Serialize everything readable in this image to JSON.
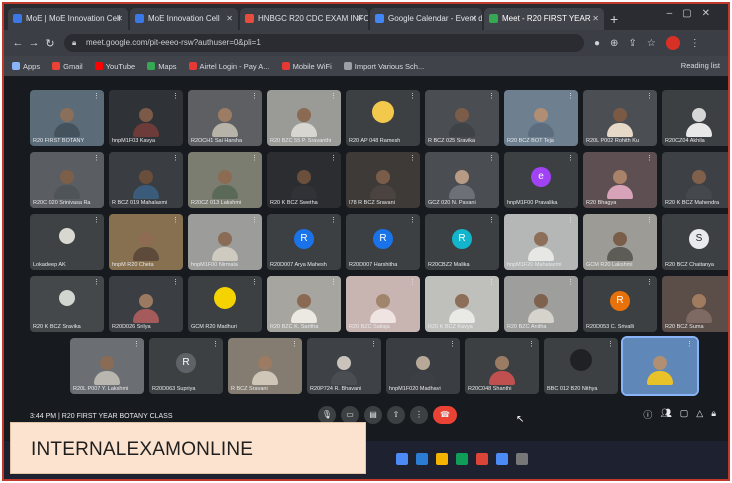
{
  "browser": {
    "tabs": [
      {
        "label": "MoE | MoE Innovation Cell",
        "fav_color": "#3b78e7"
      },
      {
        "label": "MoE Innovation Cell",
        "fav_color": "#3b78e7"
      },
      {
        "label": "HNBGC R20 CDC EXAM INFO",
        "fav_color": "#e84c3d"
      },
      {
        "label": "Google Calendar - Event de",
        "fav_color": "#4285f4"
      },
      {
        "label": "Meet - R20 FIRST YEAR",
        "fav_color": "#34a853"
      }
    ],
    "url": "meet.google.com/pit-eeeo-rsw?authuser=0&pli=1",
    "bookmarks": [
      {
        "label": "Apps",
        "color": "#8ab4f8"
      },
      {
        "label": "Gmail",
        "color": "#ea4335"
      },
      {
        "label": "YouTube",
        "color": "#ff0000"
      },
      {
        "label": "Maps",
        "color": "#34a853"
      },
      {
        "label": "Airtel Login - Pay A...",
        "color": "#e53935"
      },
      {
        "label": "Mobile WiFi",
        "color": "#e53935"
      },
      {
        "label": "Import Various Sch...",
        "color": "#9aa0a6"
      }
    ],
    "reading_list": "Reading list"
  },
  "meet": {
    "rows": [
      [
        {
          "name": "R20 FIRST BOTANY",
          "kind": "video",
          "bg": "#5b6b78",
          "skin": "#8a6f5a",
          "cloth": "#44525e"
        },
        {
          "name": "hnpM1F03 Kavya",
          "kind": "video",
          "bg": "#2f3236",
          "skin": "#7b5a47",
          "cloth": "#6e3b3b"
        },
        {
          "name": "R2OCH1 Sai Harsha",
          "kind": "video",
          "bg": "#5d5f63",
          "skin": "#9c7c62",
          "cloth": "#b7b3a8"
        },
        {
          "name": "R20 BZC 55 P. Sravanthi",
          "kind": "video",
          "bg": "#9a9a96",
          "skin": "#8a6a52",
          "cloth": "#d8d6d0"
        },
        {
          "name": "R20 AP 048 Ramesh",
          "kind": "logo",
          "bg": "#3c4043",
          "obj": "#f2c94c"
        },
        {
          "name": "R BCZ 025 Sravika",
          "kind": "video",
          "bg": "#4a4d52",
          "skin": "#7a5c48",
          "cloth": "#3f4347"
        },
        {
          "name": "R20 BCZ BOT Teja",
          "kind": "video",
          "bg": "#6e7f90",
          "skin": "#b08e74",
          "cloth": "#5c6d80"
        },
        {
          "name": "R20L P002 Rohith Ku",
          "kind": "video",
          "bg": "#4b4e53",
          "skin": "#7a5a44",
          "cloth": "#e6d9c7"
        },
        {
          "name": "R20CZ04 Akhila",
          "kind": "video",
          "bg": "#3c4043",
          "skin": "#d6d6d6",
          "cloth": "#e8e8e8"
        }
      ],
      [
        {
          "name": "R20C 020 Srinivasa Ra",
          "kind": "video",
          "bg": "#5a5d61",
          "skin": "#7d5f49",
          "cloth": "#4f5459"
        },
        {
          "name": "R BCZ 019 Mahalaxmi",
          "kind": "video",
          "bg": "#3a3d41",
          "skin": "#6a4e3c",
          "cloth": "#3a5b79"
        },
        {
          "name": "R20CZ 013 Lakshmi",
          "kind": "video",
          "bg": "#7b7d70",
          "skin": "#8c6b53",
          "cloth": "#5b6a58"
        },
        {
          "name": "R20 K BCZ Swetha",
          "kind": "video",
          "bg": "#2b2d30",
          "skin": "#6b4f3d",
          "cloth": "#2f3337"
        },
        {
          "name": "I78 R BCZ Sravani",
          "kind": "video",
          "bg": "#3e3a38",
          "skin": "#7a5d49",
          "cloth": "#4a4340"
        },
        {
          "name": "GCZ 020 N. Pavani",
          "kind": "video",
          "bg": "#4a4d51",
          "skin": "#b89b84",
          "cloth": "#6d7076"
        },
        {
          "name": "hnpM1F00 Pravalika",
          "kind": "avatar",
          "bg": "#3c4043",
          "av_color": "#a142f4",
          "letter": "e"
        },
        {
          "name": "R20 Bhagya",
          "kind": "video",
          "bg": "#5e5052",
          "skin": "#a9826a",
          "cloth": "#d8a3b8"
        },
        {
          "name": "R20 K BCZ Mahendra",
          "kind": "video",
          "bg": "#3d4044",
          "skin": "#80604a",
          "cloth": "#45494e"
        }
      ],
      [
        {
          "name": "Lokadeep AK",
          "kind": "object",
          "bg": "#3e4245",
          "obj": "#d8d8d0"
        },
        {
          "name": "hnpM R20 Cheta",
          "kind": "video",
          "bg": "#86704f",
          "skin": "#8e6b52",
          "cloth": "#5d4a3a"
        },
        {
          "name": "hnpM1F00 Nirmala",
          "kind": "video",
          "bg": "#9c9d9a",
          "skin": "#8a6b56",
          "cloth": "#cfcac0"
        },
        {
          "name": "R20D007 Arya Mahesh",
          "kind": "avatar",
          "bg": "#3c4043",
          "av_color": "#1a73e8",
          "letter": "R"
        },
        {
          "name": "R20D007 Harshitha",
          "kind": "avatar",
          "bg": "#3c4043",
          "av_color": "#1a73e8",
          "letter": "R"
        },
        {
          "name": "R20CBZ2 Malika",
          "kind": "avatar",
          "bg": "#3c4043",
          "av_color": "#12b5cb",
          "letter": "R"
        },
        {
          "name": "hnpM1F20 Mahalaxmi",
          "kind": "video",
          "bg": "#b4b7b6",
          "skin": "#8d6e58",
          "cloth": "#e7e7e5"
        },
        {
          "name": "GCM R20 Lakshmi",
          "kind": "video",
          "bg": "#9c9b95",
          "skin": "#7a5e4a",
          "cloth": "#5e5c57"
        },
        {
          "name": "R20 BCZ Chaitanya",
          "kind": "avatar",
          "bg": "#3c4043",
          "av_color": "#e8eaed",
          "letter": "S"
        }
      ],
      [
        {
          "name": "R20 K BCZ Sravika",
          "kind": "object",
          "bg": "#44484b",
          "obj": "#d2d6d0"
        },
        {
          "name": "R20D026 Srilya",
          "kind": "video",
          "bg": "#3b3e42",
          "skin": "#9c7a62",
          "cloth": "#a55b5b"
        },
        {
          "name": "GCM R20 Madhuri",
          "kind": "logo",
          "bg": "#3c4043",
          "obj": "#f5d300"
        },
        {
          "name": "R20 BZC K. Saritha",
          "kind": "video",
          "bg": "#a7a5a0",
          "skin": "#8b6a54",
          "cloth": "#ece8e2"
        },
        {
          "name": "R20 BZC Sailaja",
          "kind": "video",
          "bg": "#c8b5b2",
          "skin": "#a1846c",
          "cloth": "#f0e4e2"
        },
        {
          "name": "R20 K BCZ Kavya",
          "kind": "video",
          "bg": "#bfc0bc",
          "skin": "#8d6e58",
          "cloth": "#e9e9e6"
        },
        {
          "name": "R20 BZC Anitha",
          "kind": "video",
          "bg": "#9e9f9d",
          "skin": "#7f624e",
          "cloth": "#d6d3cd"
        },
        {
          "name": "R20D053 C. Srivalli",
          "kind": "avatar",
          "bg": "#3c4043",
          "av_color": "#e8710a",
          "letter": "R"
        },
        {
          "name": "R20 BCZ Suma",
          "kind": "video",
          "bg": "#5b4d48",
          "skin": "#a17b5f",
          "cloth": "#7e6a62"
        }
      ],
      [
        {
          "name": "R20L P007 Y. Lakshmi",
          "kind": "video",
          "bg": "#6b6f73",
          "skin": "#8a6b55",
          "cloth": "#b9b6b0"
        },
        {
          "name": "R20D063 Supriya",
          "kind": "avatar",
          "bg": "#3c4043",
          "av_color": "#5f6368",
          "letter": "R"
        },
        {
          "name": "R BCZ Sravani",
          "kind": "video",
          "bg": "#847c70",
          "skin": "#9b7b62",
          "cloth": "#cfc6b8"
        },
        {
          "name": "R20P724 R. Bhavani",
          "kind": "video",
          "bg": "#3e4246",
          "skin": "#c9c3bc",
          "cloth": "#4a4e52"
        },
        {
          "name": "hnpM1F020 Madhavi",
          "kind": "video",
          "bg": "#3a3d41",
          "skin": "#b7a898",
          "cloth": "#3c4045"
        },
        {
          "name": "R20C048 Shanthi",
          "kind": "video",
          "bg": "#3d4043",
          "skin": "#9a7b63",
          "cloth": "#c05050"
        },
        {
          "name": "BBC 012 B20 Nithya",
          "kind": "logo",
          "bg": "#3c4043",
          "obj": "#202124"
        },
        {
          "name": "",
          "kind": "video",
          "bg": "#5f88b8",
          "skin": "#b08f72",
          "cloth": "#e9c229",
          "highlight": true
        }
      ]
    ],
    "meeting_info": "3:44 PM | R20 FIRST YEAR BOTANY CLASS",
    "controls": [
      "mic-icon",
      "camera-icon",
      "captions-icon",
      "present-icon",
      "more-icon"
    ],
    "side_controls": [
      "info-icon",
      "people-icon",
      "chat-icon",
      "activities-icon",
      "lock-icon"
    ],
    "ticker_time": "3:44 PM"
  },
  "overlay": {
    "label": "INTERNALEXAMONLINE"
  }
}
